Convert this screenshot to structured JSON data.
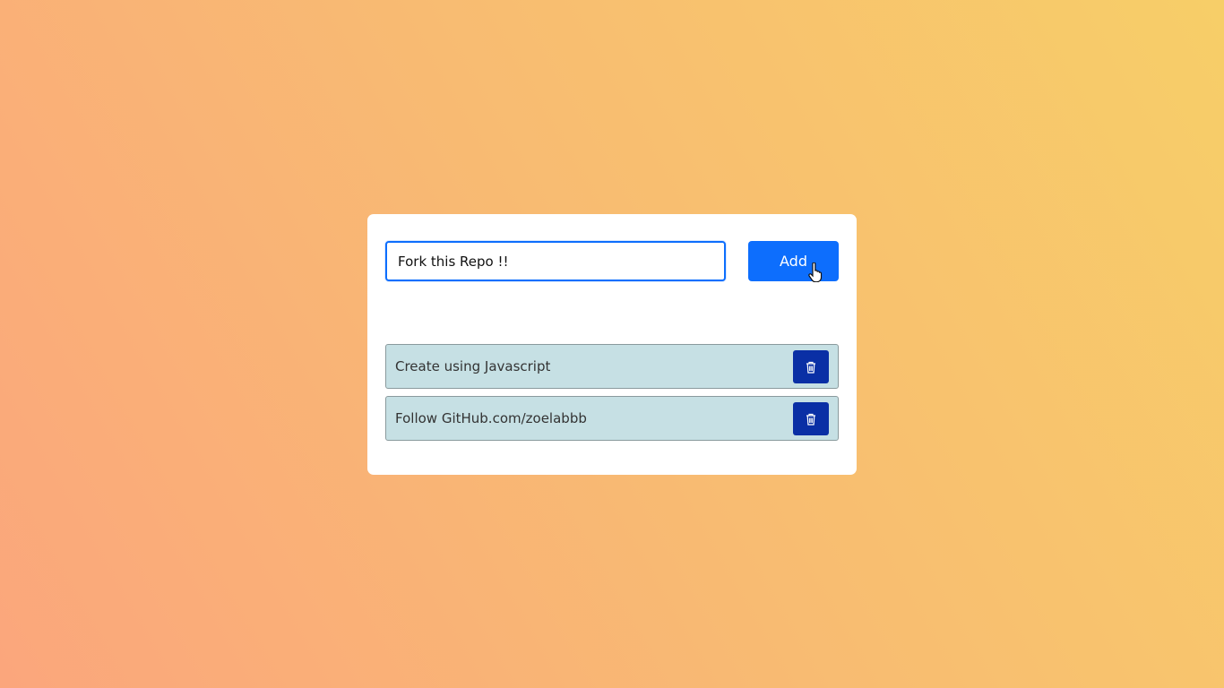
{
  "todo": {
    "input": {
      "value": "Fork this Repo !!",
      "placeholder": ""
    },
    "add_label": "Add",
    "tasks": [
      {
        "text": "Create using Javascript",
        "action_icon": "trash-icon"
      },
      {
        "text": "Follow GitHub.com/zoelabbb",
        "action_icon": "trash-icon"
      }
    ]
  },
  "colors": {
    "primary": "#0d6efd",
    "delete": "#0a2fa5",
    "task_bg": "#c6e0e4"
  }
}
